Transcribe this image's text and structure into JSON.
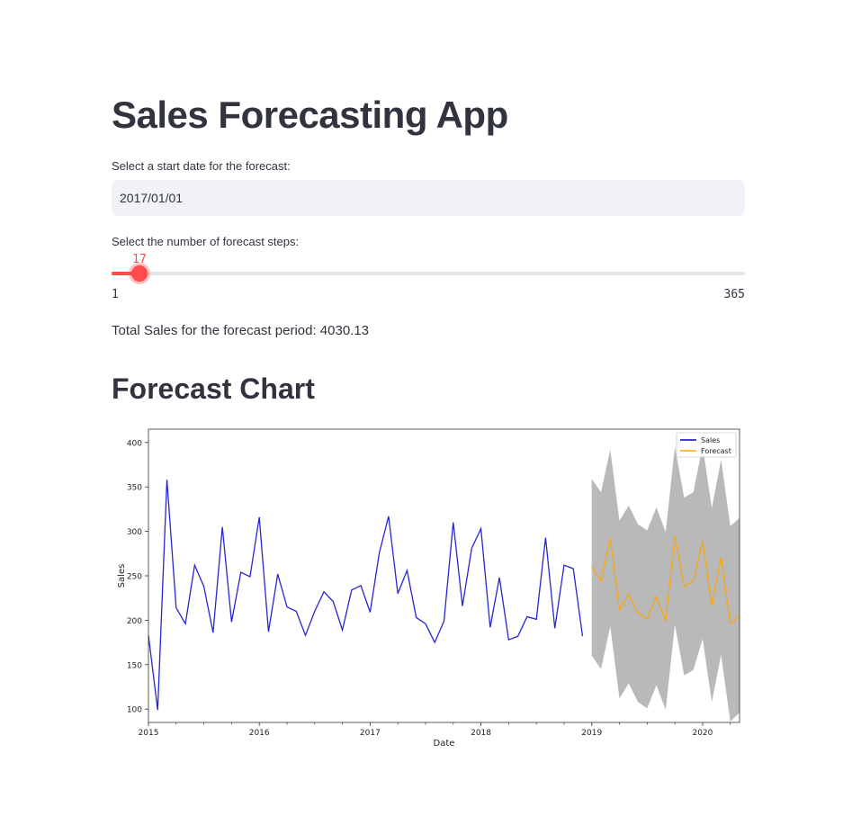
{
  "app": {
    "title": "Sales Forecasting App",
    "date_label": "Select a start date for the forecast:",
    "date_value": "2017/01/01",
    "steps_label": "Select the number of forecast steps:",
    "slider": {
      "value": "17",
      "min": "1",
      "max": "365",
      "fraction": 0.044
    },
    "total_text": "Total Sales for the forecast period: 4030.13",
    "chart_header": "Forecast Chart",
    "accent_color": "#ff4b4b"
  },
  "chart_data": {
    "type": "line",
    "xlabel": "Date",
    "ylabel": "Sales",
    "xlim": [
      "2015-01",
      "2020-05"
    ],
    "ylim": [
      85,
      415
    ],
    "x_ticks": [
      "2015",
      "2016",
      "2017",
      "2018",
      "2019",
      "2020"
    ],
    "y_ticks": [
      100,
      150,
      200,
      250,
      300,
      350,
      400
    ],
    "legend": {
      "placement": "top-right",
      "entries": [
        "Sales",
        "Forecast"
      ]
    },
    "series": [
      {
        "name": "Sales",
        "color": "#0000cc",
        "start": "2015-01",
        "values": [
          183,
          99,
          358,
          214,
          196,
          262,
          238,
          186,
          305,
          198,
          254,
          249,
          316,
          187,
          252,
          215,
          210,
          183,
          210,
          232,
          221,
          189,
          234,
          239,
          209,
          276,
          317,
          230,
          256,
          203,
          196,
          175,
          199,
          310,
          216,
          281,
          303,
          192,
          248,
          178,
          182,
          204,
          201,
          293,
          191,
          262,
          258,
          182
        ]
      },
      {
        "name": "Forecast",
        "color": "#ffa500",
        "start": "2019-01",
        "values": [
          260,
          244,
          292,
          212,
          229,
          208,
          201,
          227,
          199,
          295,
          238,
          244,
          289,
          216,
          271,
          196,
          205
        ],
        "lower": [
          160,
          145,
          193,
          112,
          129,
          108,
          101,
          127,
          99,
          195,
          138,
          144,
          179,
          108,
          161,
          86,
          96
        ],
        "upper": [
          359,
          344,
          392,
          312,
          329,
          308,
          301,
          327,
          299,
          395,
          338,
          344,
          396,
          326,
          381,
          306,
          315
        ]
      }
    ]
  }
}
